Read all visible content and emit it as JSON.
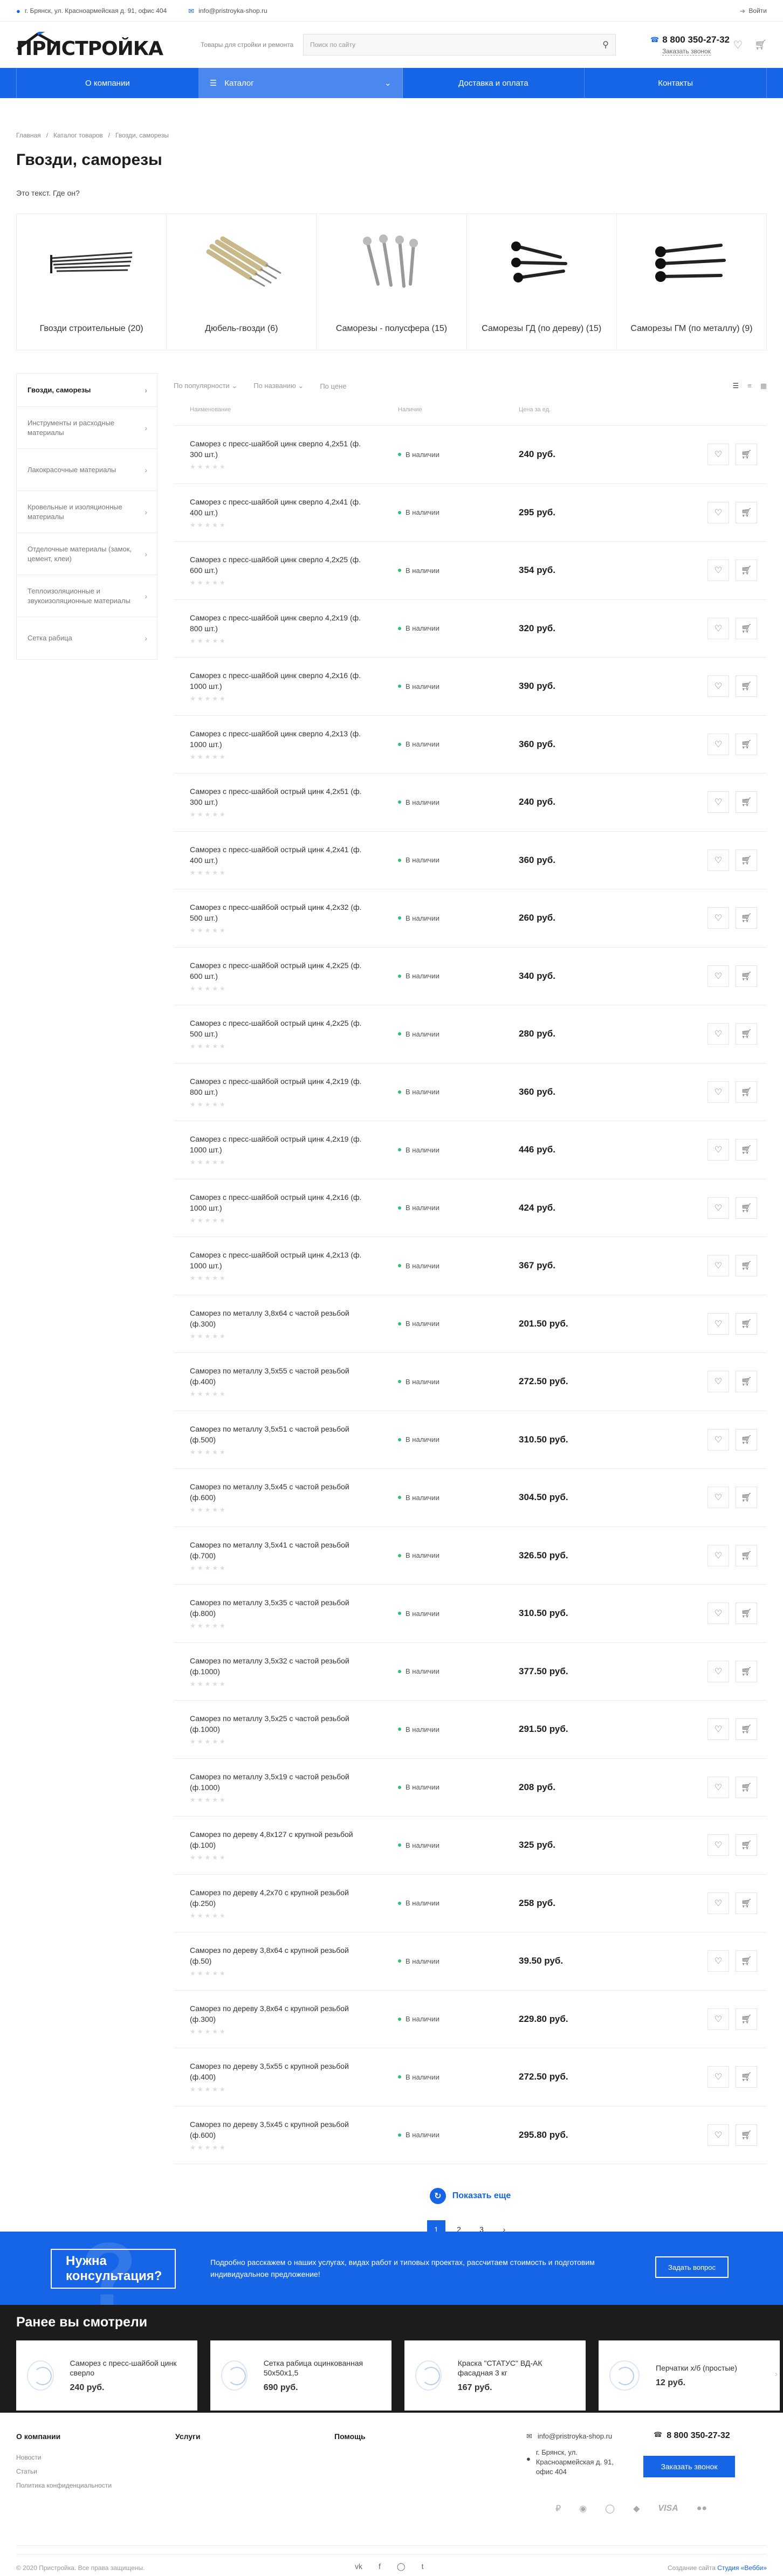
{
  "topbar": {
    "address": "г. Брянск, ул. Красноармейская д. 91, офис 404",
    "email": "info@pristroyka-shop.ru",
    "login": "Войти"
  },
  "header": {
    "logo_text": "ПРИСТРОЙКА",
    "slogan": "Товары для стройки и ремонта",
    "search_placeholder": "Поиск по сайту",
    "phone": "8 800 350-27-32",
    "callback": "Заказать звонок"
  },
  "nav": [
    {
      "label": "О компании"
    },
    {
      "label": "Каталог"
    },
    {
      "label": "Доставка и оплата"
    },
    {
      "label": "Контакты"
    }
  ],
  "breadcrumbs": [
    "Главная",
    "Каталог товаров",
    "Гвозди, саморезы"
  ],
  "page_title": "Гвозди, саморезы",
  "intro_text": "Это текст. Где он?",
  "categories": [
    {
      "name": "Гвозди строительные (20)"
    },
    {
      "name": "Дюбель-гвозди (6)"
    },
    {
      "name": "Саморезы - полусфера (15)"
    },
    {
      "name": "Саморезы ГД (по дереву) (15)"
    },
    {
      "name": "Саморезы ГМ (по металлу) (9)"
    }
  ],
  "sidebar": [
    {
      "label": "Гвозди, саморезы"
    },
    {
      "label": "Инструменты и расходные материалы"
    },
    {
      "label": "Лакокрасочные материалы"
    },
    {
      "label": "Кровельные и изоляционные материалы"
    },
    {
      "label": "Отделочные материалы (замок, цемент, клеи)"
    },
    {
      "label": "Теплоизоляционные и звукоизоляционные материалы"
    },
    {
      "label": "Сетка рабица"
    }
  ],
  "filters": {
    "sort1": "По популярности",
    "sort2": "По названию",
    "sort3": "По цене"
  },
  "table_headers": {
    "name": "Наименование",
    "stock": "Наличие",
    "price": "Цена за ед."
  },
  "stock_label": "В наличии",
  "products": [
    {
      "name": "Саморез с пресс-шайбой цинк сверло 4,2х51 (ф. 300 шт.)",
      "price": "240 руб."
    },
    {
      "name": "Саморез с пресс-шайбой цинк сверло 4,2х41 (ф. 400 шт.)",
      "price": "295 руб."
    },
    {
      "name": "Саморез с пресс-шайбой цинк сверло 4,2х25 (ф. 600 шт.)",
      "price": "354 руб."
    },
    {
      "name": "Саморез с пресс-шайбой цинк сверло 4,2х19 (ф. 800 шт.)",
      "price": "320 руб."
    },
    {
      "name": "Саморез с пресс-шайбой цинк сверло 4,2х16 (ф. 1000 шт.)",
      "price": "390 руб."
    },
    {
      "name": "Саморез с пресс-шайбой цинк сверло 4,2х13 (ф. 1000 шт.)",
      "price": "360 руб."
    },
    {
      "name": "Саморез с пресс-шайбой острый цинк 4,2х51 (ф. 300 шт.)",
      "price": "240 руб."
    },
    {
      "name": "Саморез с пресс-шайбой острый цинк 4,2х41 (ф. 400 шт.)",
      "price": "360 руб."
    },
    {
      "name": "Саморез с пресс-шайбой острый цинк 4,2х32 (ф. 500 шт.)",
      "price": "260 руб."
    },
    {
      "name": "Саморез с пресс-шайбой острый цинк 4,2х25 (ф. 600 шт.)",
      "price": "340 руб."
    },
    {
      "name": "Саморез с пресс-шайбой острый цинк 4,2х25 (ф. 500 шт.)",
      "price": "280 руб."
    },
    {
      "name": "Саморез с пресс-шайбой острый цинк 4,2х19 (ф. 800 шт.)",
      "price": "360 руб."
    },
    {
      "name": "Саморез с пресс-шайбой острый цинк 4,2х19 (ф. 1000 шт.)",
      "price": "446 руб."
    },
    {
      "name": "Саморез с пресс-шайбой острый цинк 4,2х16 (ф. 1000 шт.)",
      "price": "424 руб."
    },
    {
      "name": "Саморез с пресс-шайбой острый цинк 4,2х13 (ф. 1000 шт.)",
      "price": "367 руб."
    },
    {
      "name": "Саморез по металлу 3,8х64 с частой резьбой (ф.300)",
      "price": "201.50 руб."
    },
    {
      "name": "Саморез по металлу 3,5х55 с частой резьбой (ф.400)",
      "price": "272.50 руб."
    },
    {
      "name": "Саморез по металлу 3,5х51 с частой резьбой (ф.500)",
      "price": "310.50 руб."
    },
    {
      "name": "Саморез по металлу 3,5х45 с частой резьбой (ф.600)",
      "price": "304.50 руб."
    },
    {
      "name": "Саморез по металлу 3,5х41 с частой резьбой (ф.700)",
      "price": "326.50 руб."
    },
    {
      "name": "Саморез по металлу 3,5х35 с частой резьбой (ф.800)",
      "price": "310.50 руб."
    },
    {
      "name": "Саморез по металлу 3,5х32 с частой резьбой (ф.1000)",
      "price": "377.50 руб."
    },
    {
      "name": "Саморез по металлу 3,5х25 с частой резьбой (ф.1000)",
      "price": "291.50 руб."
    },
    {
      "name": "Саморез по металлу 3,5х19 с частой резьбой (ф.1000)",
      "price": "208 руб."
    },
    {
      "name": "Саморез по дереву 4,8х127 с крупной резьбой (ф.100)",
      "price": "325 руб."
    },
    {
      "name": "Саморез по дереву 4,2х70 с крупной резьбой (ф.250)",
      "price": "258 руб."
    },
    {
      "name": "Саморез по дереву 3,8х64 с крупной резьбой (ф.50)",
      "price": "39.50 руб."
    },
    {
      "name": "Саморез по дереву 3,8х64 с крупной резьбой (ф.300)",
      "price": "229.80 руб."
    },
    {
      "name": "Саморез по дереву 3,5х55 с крупной резьбой (ф.400)",
      "price": "272.50 руб."
    },
    {
      "name": "Саморез по дереву 3,5х45 с крупной резьбой (ф.600)",
      "price": "295.80 руб."
    }
  ],
  "show_more": "Показать еще",
  "pagination": [
    "1",
    "2",
    "3"
  ],
  "consult": {
    "title": "Нужна консультация?",
    "text": "Подробно расскажем о наших услугах, видах работ и типовых проектах, рассчитаем стоимость и подготовим индивидуальное предложение!",
    "button": "Задать вопрос"
  },
  "recent": {
    "title": "Ранее вы смотрели",
    "items": [
      {
        "name": "Саморез с пресс-шайбой цинк сверло",
        "price": "240 руб."
      },
      {
        "name": "Сетка рабица оцинкованная 50х50х1,5",
        "price": "690 руб."
      },
      {
        "name": "Краска \"СТАТУС\" ВД-АК фасадная 3 кг",
        "price": "167 руб."
      },
      {
        "name": "Перчатки х/б (простые)",
        "price": "12 руб."
      }
    ]
  },
  "footer": {
    "col1_title": "О компании",
    "col1_links": [
      "Новости",
      "Статьи",
      "Политика конфиденциальности"
    ],
    "col2_title": "Услуги",
    "col3_title": "Помощь",
    "email": "info@pristroyka-shop.ru",
    "address": "г. Брянск, ул. Красноармейская д. 91, офис 404",
    "phone": "8 800 350-27-32",
    "callback_button": "Заказать звонок",
    "copyright": "© 2020 Пристройка. Все права защищены.",
    "made_by_prefix": "Создание сайта",
    "made_by_name": "Студия «Вебби»",
    "payment_labels": [
      "VISA"
    ]
  },
  "colors": {
    "accent": "#1565e6",
    "in_stock": "#2fbf71",
    "dark": "#1c1c1c"
  }
}
